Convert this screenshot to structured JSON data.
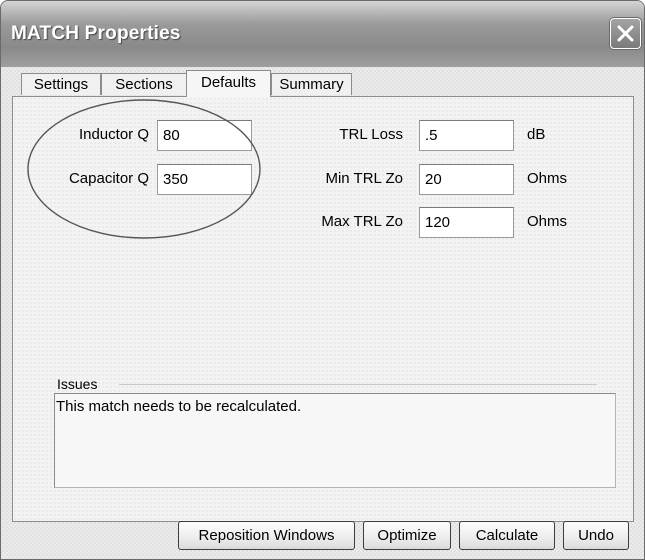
{
  "window": {
    "title": "MATCH Properties"
  },
  "tabs": [
    {
      "label": "Settings",
      "active": false
    },
    {
      "label": "Sections",
      "active": false
    },
    {
      "label": "Defaults",
      "active": true
    },
    {
      "label": "Summary",
      "active": false
    }
  ],
  "defaults": {
    "inductor_q": {
      "label": "Inductor Q",
      "value": "80"
    },
    "capacitor_q": {
      "label": "Capacitor Q",
      "value": "350"
    },
    "trl_loss": {
      "label": "TRL Loss",
      "value": ".5",
      "unit": "dB"
    },
    "min_trl_zo": {
      "label": "Min TRL Zo",
      "value": "20",
      "unit": "Ohms"
    },
    "max_trl_zo": {
      "label": "Max TRL Zo",
      "value": "120",
      "unit": "Ohms"
    }
  },
  "issues": {
    "label": "Issues",
    "text": "This match needs to be recalculated."
  },
  "buttons": {
    "reposition": "Reposition Windows",
    "optimize": "Optimize",
    "calculate": "Calculate",
    "undo": "Undo"
  },
  "colors": {
    "title_bar": "#8a8a8a",
    "highlight_ellipse": "#555555"
  }
}
